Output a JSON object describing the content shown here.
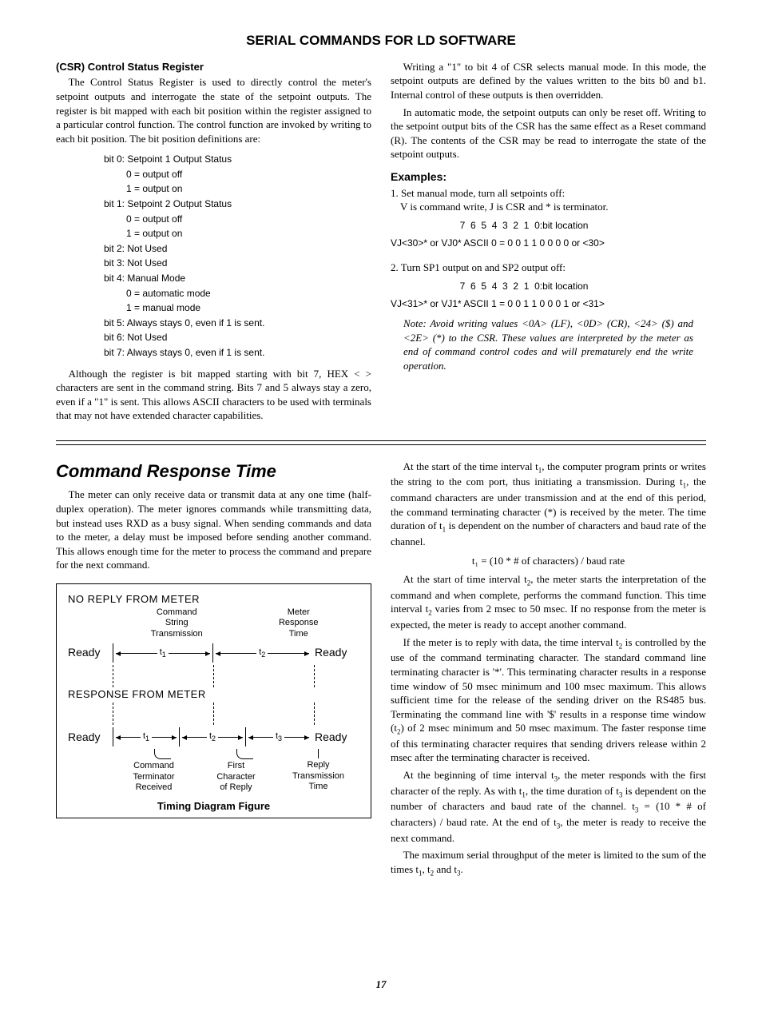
{
  "title": "SERIAL COMMANDS FOR LD SOFTWARE",
  "csr": {
    "heading": "(CSR) Control Status Register",
    "intro": "The Control Status Register is used to directly control the meter's setpoint outputs and interrogate the state of the setpoint outputs. The register is bit mapped with each bit position within the register assigned to a particular control function. The control function are invoked by writing to each bit position. The bit position definitions are:",
    "bits": [
      {
        "label": "bit 0: Setpoint 1 Output Status",
        "subs": [
          "0 = output off",
          "1 = output on"
        ]
      },
      {
        "label": "bit 1: Setpoint 2 Output Status",
        "subs": [
          "0 = output off",
          "1 = output on"
        ]
      },
      {
        "label": "bit 2: Not Used",
        "subs": []
      },
      {
        "label": "bit 3: Not Used",
        "subs": []
      },
      {
        "label": "bit 4: Manual Mode",
        "subs": [
          "0 = automatic mode",
          "1 = manual mode"
        ]
      },
      {
        "label": "bit 5: Always stays 0, even if 1 is sent.",
        "subs": []
      },
      {
        "label": "bit 6: Not Used",
        "subs": []
      },
      {
        "label": "bit 7: Always stays 0, even if 1 is sent.",
        "subs": []
      }
    ],
    "after": "Although the register is bit mapped starting with bit 7, HEX < > characters are sent in the command string. Bits 7 and 5 always stay a zero, even if a \"1\" is sent. This allows ASCII characters to be used with terminals that may not have extended character capabilities."
  },
  "right": {
    "p1": "Writing a \"1\" to bit 4 of CSR selects manual mode. In this mode, the setpoint outputs are defined by the values written to the bits b0 and b1. Internal control of these outputs is then overridden.",
    "p2": "In automatic mode, the setpoint outputs can only be reset off. Writing to the setpoint output bits of the CSR has the same effect as a Reset command (R). The contents of the CSR may be read to interrogate the state of the setpoint outputs.",
    "ex_head": "Examples:",
    "ex1_desc": "1. Set manual mode, turn all setpoints off:",
    "ex1_note": "V is command write, J is CSR and * is terminator.",
    "ex1_header": "                          7  6  5  4  3  2  1  0:bit location",
    "ex1_row": "VJ<30>* or VJ0*      ASCII 0 =  0  0  1  1  0  0  0  0  or <30>",
    "ex2_desc": "2. Turn SP1 output on and SP2 output off:",
    "ex2_header": "                          7  6  5  4  3  2  1  0:bit location",
    "ex2_row": "VJ<31>* or VJ1*      ASCII 1 =  0  0  1  1  0  0  0  1  or <31>",
    "note": "Note: Avoid writing values <0A> (LF), <0D> (CR), <24> ($) and <2E> (*) to the CSR. These values are interpreted by the meter as end of command control codes and will prematurely end the write operation."
  },
  "crt": {
    "title": "Command Response Time",
    "p1": "The meter can only receive data or transmit data at any one time (half-duplex operation). The meter ignores commands while transmitting data, but instead uses RXD as a busy signal. When sending commands and data to the meter, a delay must be imposed before sending another command. This allows enough time for the meter to process the command and prepare for the next command.",
    "diagram": {
      "head1": "NO REPLY FROM METER",
      "lab_a": "Command\nString\nTransmission",
      "lab_b": "Meter\nResponse\nTime",
      "ready": "Ready",
      "t1": "t",
      "t1s": "1",
      "t2": "t",
      "t2s": "2",
      "t3": "t",
      "t3s": "3",
      "head2": "RESPONSE FROM METER",
      "bl1": "Command\nTerminator\nReceived",
      "bl2": "First\nCharacter\nof Reply",
      "bl3": "Reply\nTransmission\nTime",
      "caption": "Timing Diagram Figure"
    },
    "rp1a": "At the start of the time interval t",
    "rp1b": ", the computer program prints or writes the string to the com port, thus initiating a transmission. During t",
    "rp1c": ", the command characters are under transmission and at the end of this period, the command terminating character (*) is received by the meter. The time duration of t",
    "rp1d": " is dependent on the number of characters and baud rate of the channel.",
    "formula": "t₁ = (10 * # of characters) / baud rate",
    "rp2a": "At the start of time interval t",
    "rp2b": ", the meter starts the interpretation of the command and when complete, performs the command function. This time interval t",
    "rp2c": " varies from 2 msec to 50 msec. If no response from the meter is expected, the meter is ready to accept another command.",
    "rp3a": "If the meter is to reply with data, the time interval t",
    "rp3b": " is controlled by the use of the command terminating character. The standard command line terminating character is '*'. This terminating character results in a response time window of 50 msec minimum and 100 msec maximum. This allows sufficient time for the release of the sending driver on the RS485 bus. Terminating the command line with '$' results in a response time window (t",
    "rp3c": ") of 2 msec minimum and 50 msec maximum. The faster response time of this terminating character requires that sending drivers release within 2 msec after the terminating character is received.",
    "rp4a": "At the beginning of time interval t",
    "rp4b": ", the meter responds with the first character of the reply. As with t",
    "rp4c": ", the time duration of t",
    "rp4d": " is dependent on the number of characters and baud rate of the channel. t",
    "rp4e": " = (10 * # of characters) / baud rate. At the end of t",
    "rp4f": ", the meter is ready to receive the next command.",
    "rp5a": "The maximum serial throughput of the meter is limited to the sum of the times t",
    "rp5b": ", t",
    "rp5c": " and t",
    "rp5d": "."
  },
  "page": "17"
}
